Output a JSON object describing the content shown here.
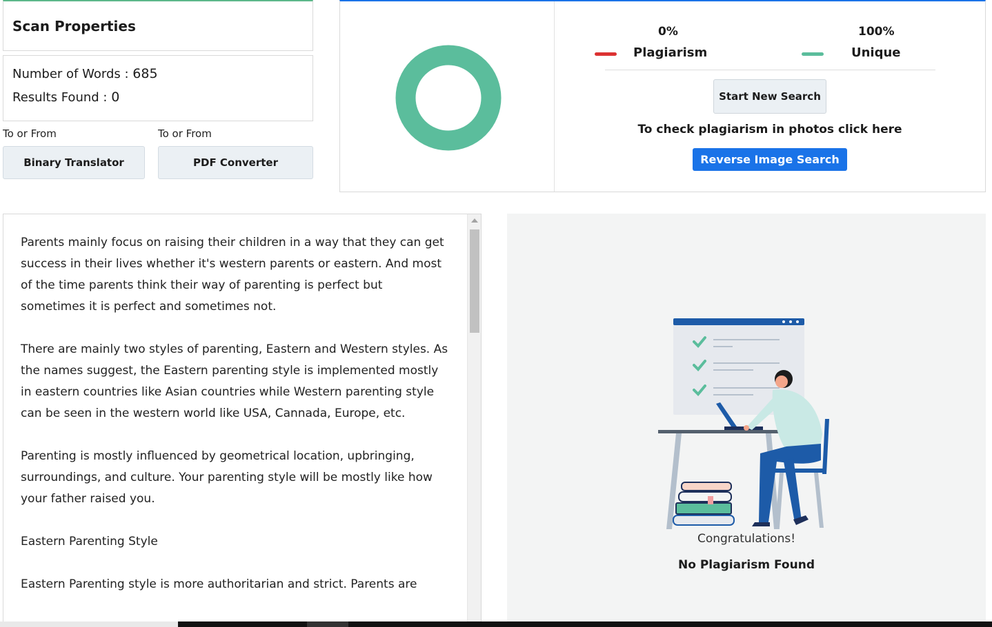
{
  "scan": {
    "title": "Scan Properties",
    "words_label": "Number of Words :",
    "words_value": "685",
    "results_label": "Results Found :",
    "results_value": "0"
  },
  "tools": {
    "to_from_1": "To or From",
    "to_from_2": "To or From",
    "binary_label": "Binary Translator",
    "pdf_label": "PDF Converter"
  },
  "summary": {
    "plagiarism_pct": "0%",
    "plagiarism_label": "Plagiarism",
    "unique_pct": "100%",
    "unique_label": "Unique",
    "start_label": "Start New Search",
    "photo_text": "To check plagiarism in photos click here",
    "reverse_label": "Reverse Image Search",
    "plagiarism_fraction": 0,
    "unique_fraction": 1
  },
  "colors": {
    "plagiarism": "#dc3232",
    "unique": "#5bbd9c",
    "accent_blue": "#1a73e8",
    "accent_green": "#5cb88a"
  },
  "text": {
    "paragraphs": [
      "Parents mainly focus on raising their children in a way that they can get success in their lives whether it's western parents or eastern. And most of the time parents think their way of parenting is perfect but sometimes it is perfect and sometimes not.",
      "There are mainly two styles of parenting, Eastern and Western styles. As the names suggest, the Eastern parenting style is implemented mostly in eastern countries like Asian countries while Western parenting style can be seen in the western world like USA, Cannada, Europe, etc.",
      "Parenting is mostly influenced by geometrical location, upbringing, surroundings, and culture. Your parenting style will be mostly like how your father raised you.",
      "Eastern Parenting Style",
      "Eastern Parenting style is more authoritarian and strict. Parents are"
    ]
  },
  "result": {
    "congrats": "Congratulations!",
    "no_plagiarism": "No Plagiarism Found"
  }
}
